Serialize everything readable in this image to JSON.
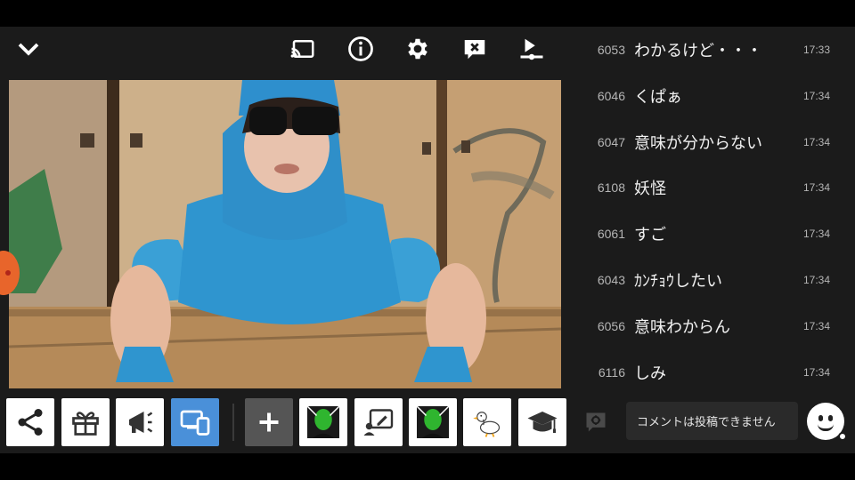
{
  "topbar": {
    "icons": [
      "collapse-chevron-icon",
      "cast-icon",
      "info-icon",
      "gear-icon",
      "comment-off-icon",
      "queue-play-icon"
    ]
  },
  "actions": {
    "buttons": [
      "share-icon",
      "gift-icon",
      "megaphone-icon",
      "screen-switch-icon",
      "add-icon",
      "green-face-icon",
      "draw-icon",
      "green-face-icon",
      "duck-icon",
      "graduation-cap-icon"
    ],
    "active_color": "#4a90d9"
  },
  "comments": [
    {
      "num": "6053",
      "text": "わかるけど・・・",
      "time": "17:33"
    },
    {
      "num": "6046",
      "text": "くぱぁ",
      "time": "17:34"
    },
    {
      "num": "6047",
      "text": "意味が分からない",
      "time": "17:34"
    },
    {
      "num": "6108",
      "text": "妖怪",
      "time": "17:34"
    },
    {
      "num": "6061",
      "text": "すご",
      "time": "17:34"
    },
    {
      "num": "6043",
      "text": "ｶﾝﾁｮｳしたい",
      "time": "17:34"
    },
    {
      "num": "6056",
      "text": "意味わからん",
      "time": "17:34"
    },
    {
      "num": "6116",
      "text": "しみ",
      "time": "17:34"
    }
  ],
  "comment_box": {
    "placeholder": "コメントは投稿できません"
  }
}
